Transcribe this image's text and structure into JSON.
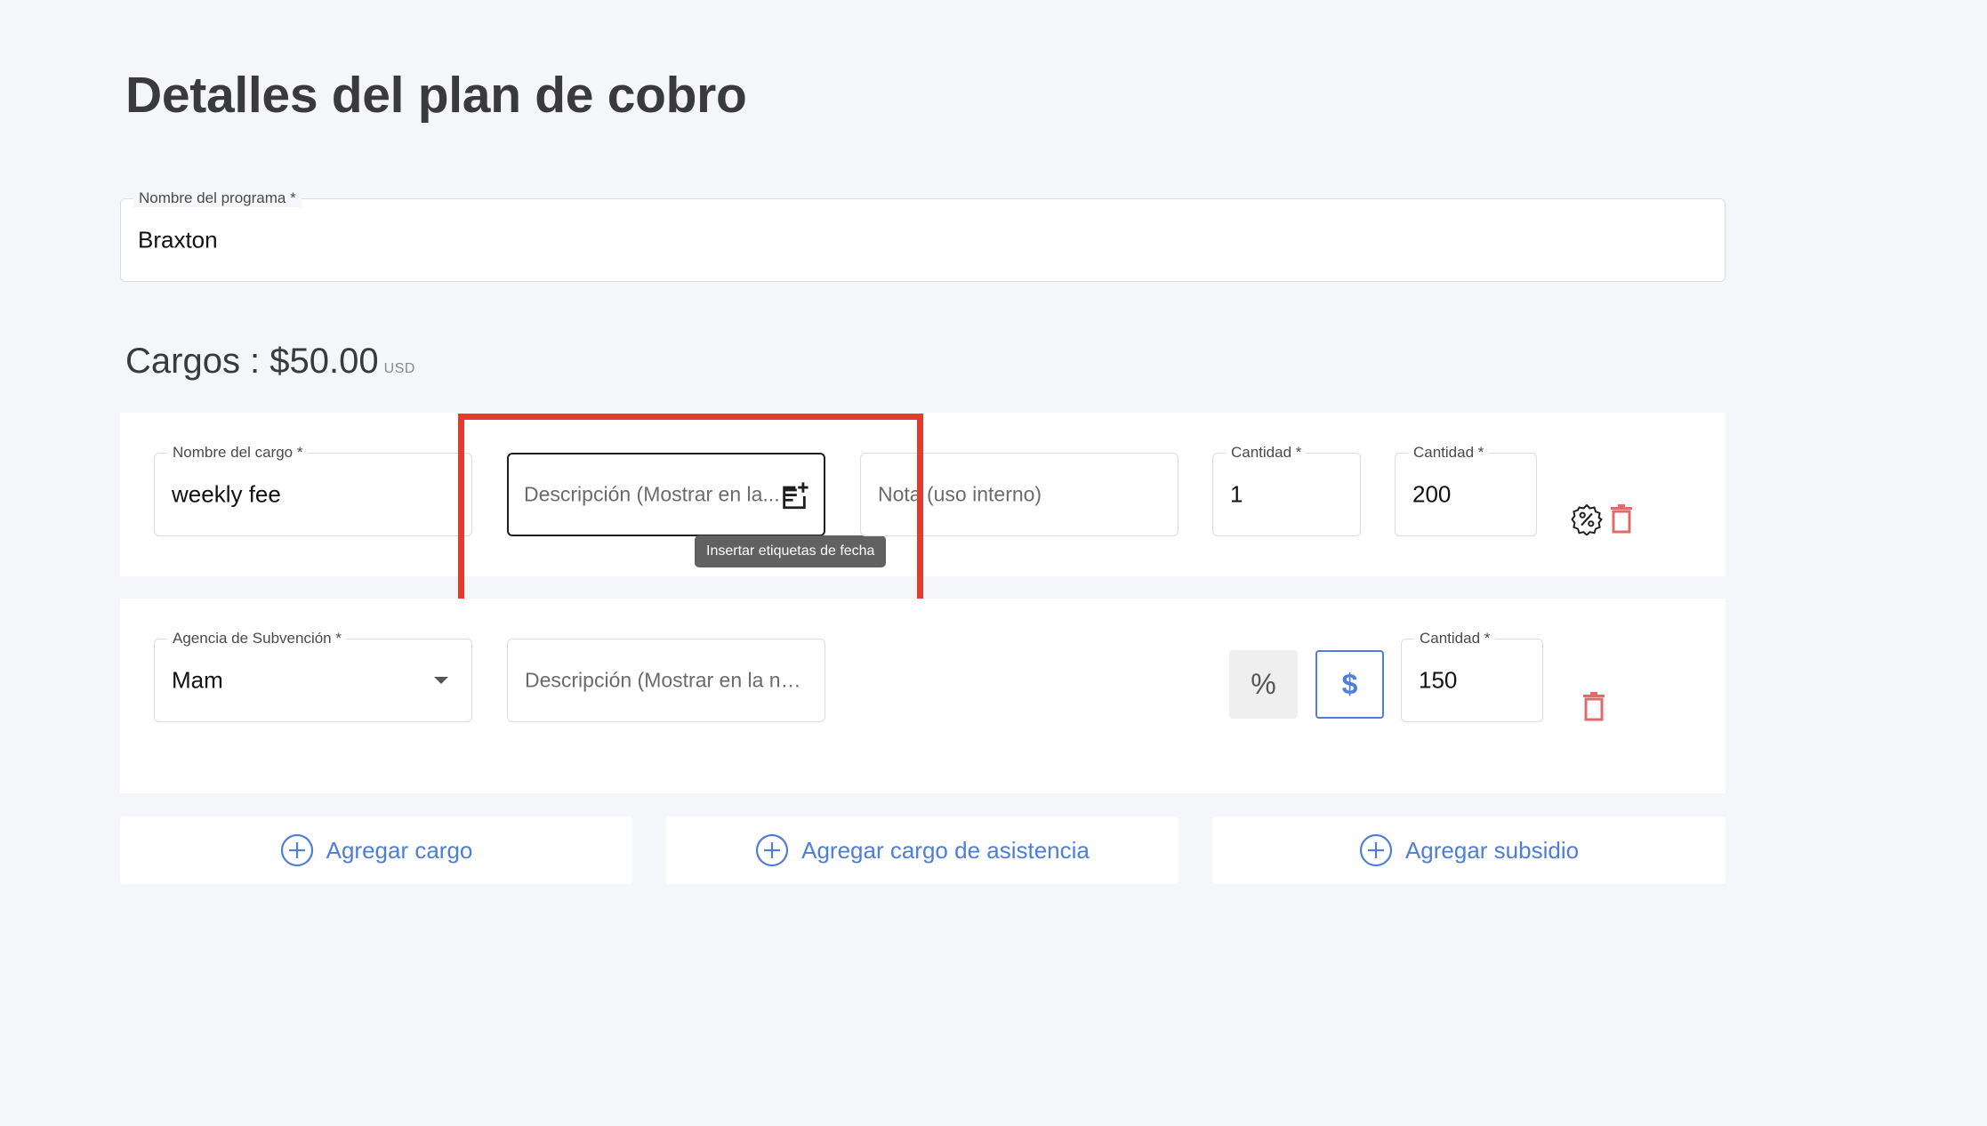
{
  "page": {
    "title": "Detalles del plan de cobro"
  },
  "program": {
    "label": "Nombre del programa *",
    "value": "Braxton"
  },
  "charges": {
    "title": "Cargos : $50.00",
    "currency": "USD",
    "charge_row": {
      "name_label": "Nombre del cargo *",
      "name_value": "weekly fee",
      "description_placeholder": "Descripción (Mostrar en la...",
      "note_placeholder": "Nota (uso interno)",
      "quantity_label": "Cantidad *",
      "quantity_value": "1",
      "amount_label": "Cantidad *",
      "amount_value": "200",
      "tooltip": "Insertar etiquetas de fecha"
    },
    "subsidy_row": {
      "agency_label": "Agencia de Subvención *",
      "agency_value": "Mam",
      "description_placeholder": "Descripción (Mostrar en la not...",
      "percent_symbol": "%",
      "dollar_symbol": "$",
      "amount_label": "Cantidad *",
      "amount_value": "150"
    }
  },
  "actions": {
    "add_charge": "Agregar cargo",
    "add_attendance_charge": "Agregar cargo de asistencia",
    "add_subsidy": "Agregar subsidio"
  },
  "colors": {
    "accent": "#4e7ed8",
    "delete": "#e06b6b",
    "highlight": "#e53a2c"
  }
}
